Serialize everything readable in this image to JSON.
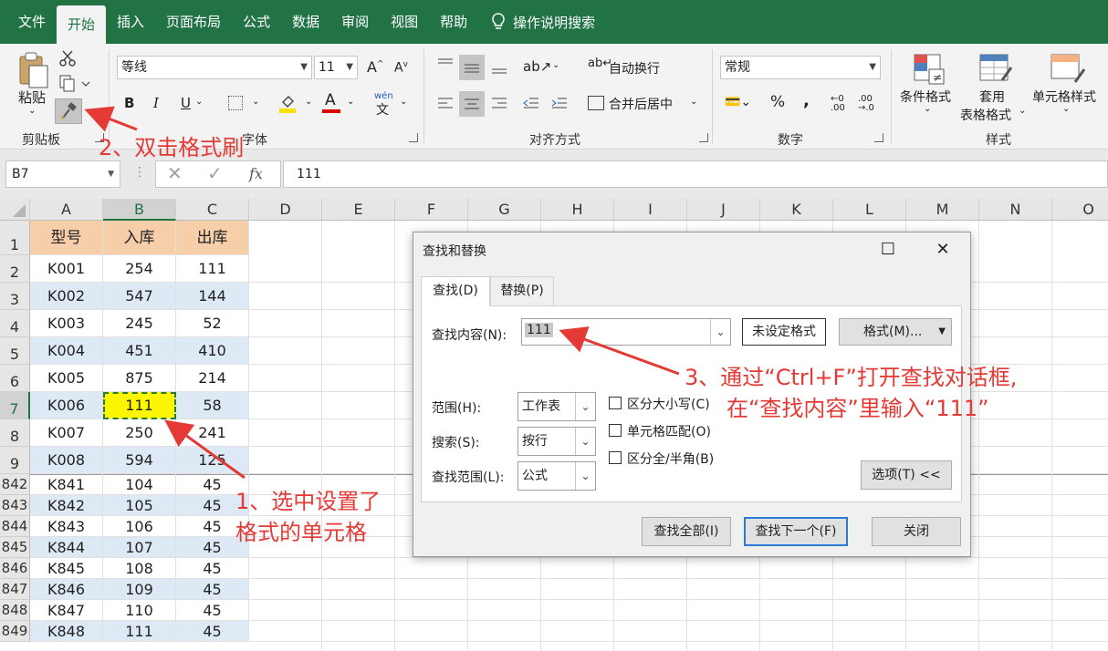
{
  "menu": {
    "tabs": [
      "文件",
      "开始",
      "插入",
      "页面布局",
      "公式",
      "数据",
      "审阅",
      "视图",
      "帮助"
    ],
    "tell_me": "操作说明搜索"
  },
  "ribbon": {
    "clipboard": {
      "paste": "粘贴",
      "label": "剪贴板"
    },
    "font": {
      "name": "等线",
      "size": "11",
      "label": "字体",
      "bold": "B",
      "italic": "I",
      "underline": "U",
      "font_color_glyph": "A",
      "wen": "wén"
    },
    "alignment": {
      "wrap": "自动换行",
      "merge": "合并后居中",
      "label": "对齐方式"
    },
    "number": {
      "format": "常规",
      "percent": "%",
      "comma": ",",
      "label": "数字"
    },
    "styles": {
      "conditional": "条件格式",
      "table_line1": "套用",
      "table_line2": "表格格式",
      "cell_styles": "单元格样式",
      "label": "样式"
    }
  },
  "formula_bar": {
    "name_box": "B7",
    "fx": "fx",
    "content": "111"
  },
  "columns": [
    "A",
    "B",
    "C",
    "D",
    "E",
    "F",
    "G",
    "H",
    "I",
    "J",
    "K",
    "L",
    "M",
    "N",
    "O"
  ],
  "table": {
    "headers": [
      "型号",
      "入库",
      "出库"
    ],
    "rows": [
      {
        "row": "2",
        "cells": [
          "K001",
          "254",
          "111"
        ]
      },
      {
        "row": "3",
        "cells": [
          "K002",
          "547",
          "144"
        ]
      },
      {
        "row": "4",
        "cells": [
          "K003",
          "245",
          "52"
        ]
      },
      {
        "row": "5",
        "cells": [
          "K004",
          "451",
          "410"
        ]
      },
      {
        "row": "6",
        "cells": [
          "K005",
          "875",
          "214"
        ]
      },
      {
        "row": "7",
        "cells": [
          "K006",
          "111",
          "58"
        ]
      },
      {
        "row": "8",
        "cells": [
          "K007",
          "250",
          "241"
        ]
      },
      {
        "row": "9",
        "cells": [
          "K008",
          "594",
          "125"
        ]
      },
      {
        "row": "842",
        "cells": [
          "K841",
          "104",
          "45"
        ]
      },
      {
        "row": "843",
        "cells": [
          "K842",
          "105",
          "45"
        ]
      },
      {
        "row": "844",
        "cells": [
          "K843",
          "106",
          "45"
        ]
      },
      {
        "row": "845",
        "cells": [
          "K844",
          "107",
          "45"
        ]
      },
      {
        "row": "846",
        "cells": [
          "K845",
          "108",
          "45"
        ]
      },
      {
        "row": "847",
        "cells": [
          "K846",
          "109",
          "45"
        ]
      },
      {
        "row": "848",
        "cells": [
          "K847",
          "110",
          "45"
        ]
      },
      {
        "row": "849",
        "cells": [
          "K848",
          "111",
          "45"
        ]
      }
    ],
    "header_row": "1"
  },
  "dialog": {
    "title": "查找和替换",
    "tab_find": "查找(D)",
    "tab_replace": "替换(P)",
    "find_what_label": "查找内容(N):",
    "find_what_value": "111",
    "no_format": "未设定格式",
    "format_btn": "格式(M)...",
    "within_label": "范围(H):",
    "within_value": "工作表",
    "search_label": "搜索(S):",
    "search_value": "按行",
    "lookin_label": "查找范围(L):",
    "lookin_value": "公式",
    "match_case": "区分大小写(C)",
    "match_entire": "单元格匹配(O)",
    "match_byte": "区分全/半角(B)",
    "options_btn": "选项(T) <<",
    "find_all": "查找全部(I)",
    "find_next": "查找下一个(F)",
    "close": "关闭"
  },
  "annotations": {
    "step1_line1": "1、选中设置了",
    "step1_line2": "格式的单元格",
    "step2": "2、双击格式刷",
    "step3_line1": "3、通过“Ctrl+F”打开查找对话框,",
    "step3_line2": "在“查找内容”里输入“111”"
  },
  "colors": {
    "excel_green": "#217346",
    "header_fill": "#f7ceaa",
    "band_fill": "#dde9f4",
    "highlight": "#fcf700",
    "annotation": "#e53935"
  }
}
